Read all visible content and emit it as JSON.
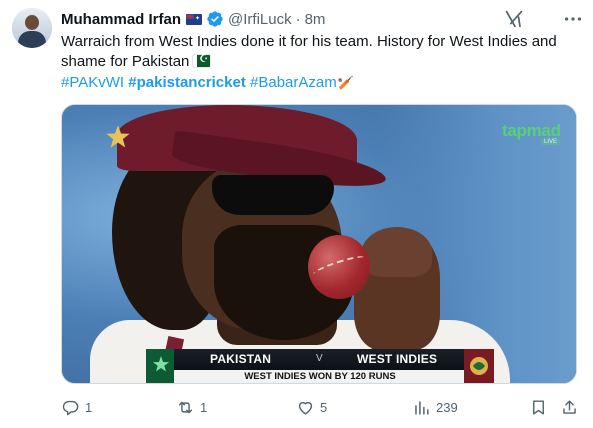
{
  "tweet": {
    "author_name": "Muhammad Irfan",
    "handle": "@IrfiLuck",
    "separator": "·",
    "time": "8m",
    "text": "Warraich from West Indies done it for his team. History for West Indies and shame for Pakistan",
    "hashtags": [
      "#PAKvWI",
      "#pakistancricket",
      "#BabarAzam"
    ],
    "cricket_emoji": "🏏"
  },
  "media": {
    "broadcaster": "tapmad",
    "broadcaster_sub": "LIVE",
    "scorebar": {
      "team_home": "PAKISTAN",
      "versus": "V",
      "team_away": "WEST INDIES",
      "result": "WEST INDIES WON BY 120 RUNS"
    }
  },
  "actions": {
    "replies": "1",
    "reposts": "1",
    "likes": "5",
    "views": "239"
  },
  "colors": {
    "link": "#1d9bf0",
    "verified": "#1d9bf0",
    "muted": "#536471",
    "text": "#0f1419"
  },
  "icons": [
    "grok-icon",
    "more-icon",
    "verified-badge-icon",
    "australia-flag-icon",
    "pakistan-flag-icon",
    "reply-icon",
    "repost-icon",
    "like-icon",
    "views-icon",
    "bookmark-icon",
    "share-icon"
  ]
}
